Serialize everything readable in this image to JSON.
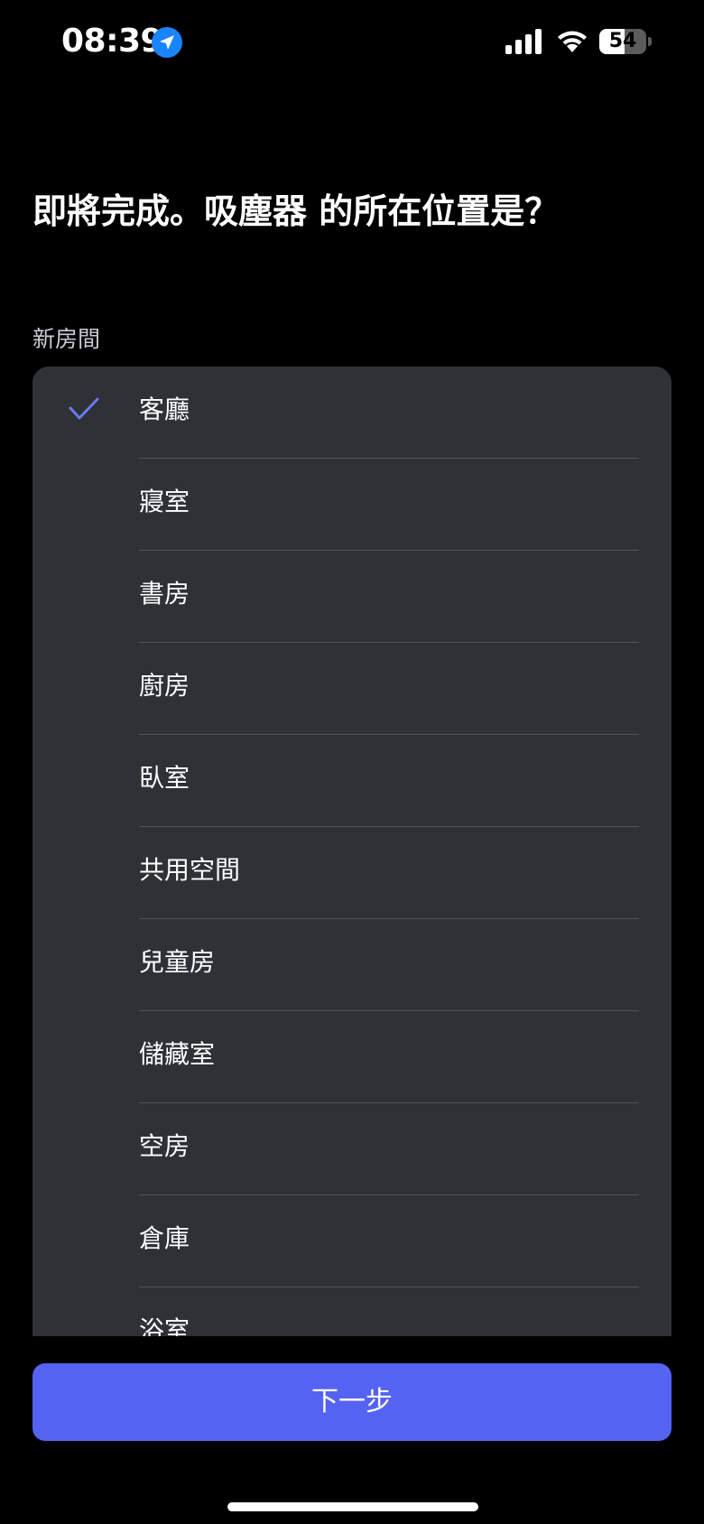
{
  "status_bar": {
    "time": "08:39",
    "battery_level": "54",
    "battery_percent": 54,
    "icons": [
      "location-arrow-icon",
      "signal-icon",
      "wifi-icon",
      "battery-icon"
    ]
  },
  "title": "即將完成。吸塵器 的所在位置是？",
  "section_label": "新房間",
  "rooms": [
    {
      "label": "客廳",
      "selected": true
    },
    {
      "label": "寢室",
      "selected": false
    },
    {
      "label": "書房",
      "selected": false
    },
    {
      "label": "廚房",
      "selected": false
    },
    {
      "label": "臥室",
      "selected": false
    },
    {
      "label": "共用空間",
      "selected": false
    },
    {
      "label": "兒童房",
      "selected": false
    },
    {
      "label": "儲藏室",
      "selected": false
    },
    {
      "label": "空房",
      "selected": false
    },
    {
      "label": "倉庫",
      "selected": false
    },
    {
      "label": "浴室",
      "selected": false
    }
  ],
  "next_button_label": "下一步",
  "colors": {
    "accent": "#5563f2",
    "check": "#6b78f5",
    "card": "#2e3135",
    "background": "#000000",
    "location_badge": "#1a84ff"
  }
}
